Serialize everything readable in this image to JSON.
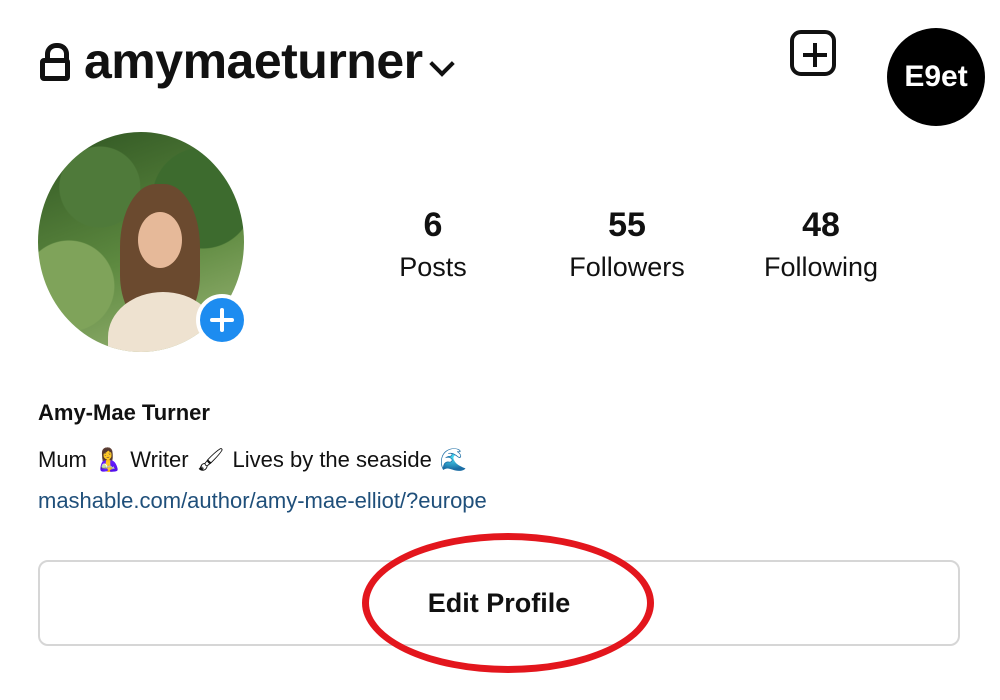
{
  "header": {
    "username": "amymaeturner",
    "brand_badge": "E9et"
  },
  "stats": [
    {
      "value": "6",
      "label": "Posts"
    },
    {
      "value": "55",
      "label": "Followers"
    },
    {
      "value": "48",
      "label": "Following"
    }
  ],
  "bio": {
    "name": "Amy-Mae Turner",
    "segments": [
      "Mum",
      "Writer",
      "Lives by the seaside"
    ],
    "emojis": [
      "🤱",
      "🖌",
      "🌊"
    ],
    "link": "mashable.com/author/amy-mae-elliot/?europe"
  },
  "actions": {
    "edit_profile": "Edit Profile"
  },
  "colors": {
    "link": "#1f4f7a",
    "story_add": "#1d8cf0",
    "annotation": "#e3161d"
  }
}
